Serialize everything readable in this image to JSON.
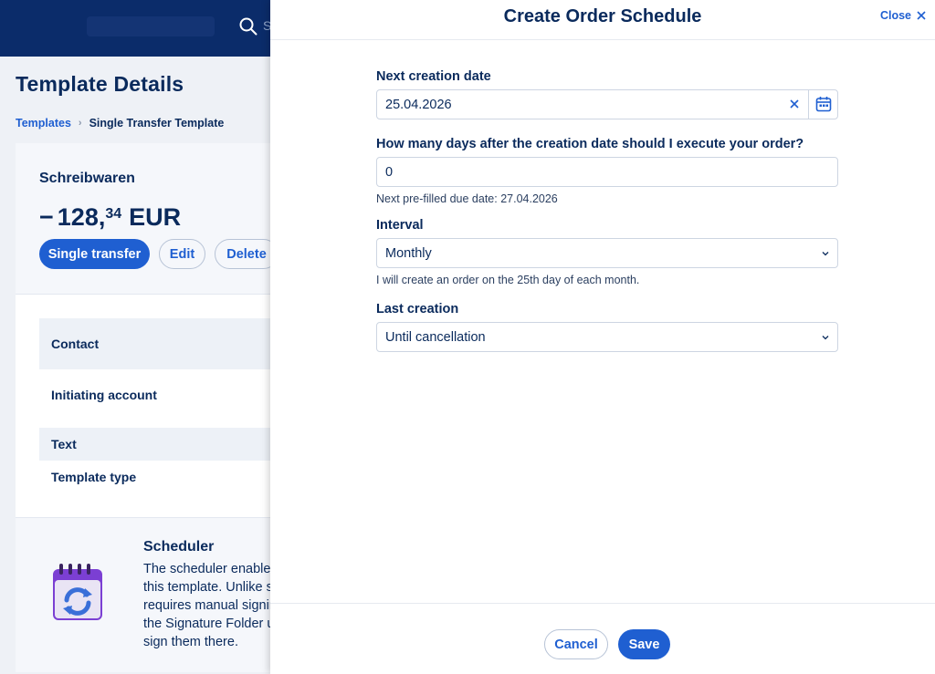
{
  "topbar": {
    "search_placeholder": "S"
  },
  "page": {
    "title": "Template Details",
    "breadcrumb": {
      "link": "Templates",
      "current": "Single Transfer Template"
    }
  },
  "card": {
    "name": "Schreibwaren",
    "amount": {
      "sign": "−",
      "integer": "128,",
      "decimals": "34",
      "currency": "EUR"
    },
    "chips": {
      "type": "Single transfer",
      "edit": "Edit",
      "delete": "Delete"
    },
    "rows": {
      "contact": "Contact",
      "initiating_account": "Initiating account",
      "text": "Text",
      "template_type": "Template type"
    },
    "scheduler": {
      "title": "Scheduler",
      "lines": [
        "The scheduler enables",
        "this template. Unlike s",
        "requires manual signin",
        "the Signature Folder u",
        "sign them there."
      ]
    }
  },
  "modal": {
    "title": "Create Order Schedule",
    "close_label": "Close",
    "fields": {
      "next_creation": {
        "label": "Next creation date",
        "value": "25.04.2026"
      },
      "days_after": {
        "label": "How many days after the creation date should I execute your order?",
        "value": "0",
        "helper": "Next pre-filled due date: 27.04.2026"
      },
      "interval": {
        "label": "Interval",
        "value": "Monthly",
        "helper": "I will create an order on the 25th day of each month."
      },
      "last_creation": {
        "label": "Last creation",
        "value": "Until cancellation"
      }
    },
    "cancel_label": "Cancel",
    "save_label": "Save"
  },
  "colors": {
    "brand_dark": "#0b2c6a",
    "primary": "#1f5fd1",
    "text": "#0a2a5c"
  },
  "icons": {
    "search": "search-icon",
    "close": "close-icon",
    "clear": "clear-icon",
    "calendar": "calendar-icon",
    "chevron": "chevron-down-icon",
    "scheduler": "calendar-refresh-icon"
  }
}
